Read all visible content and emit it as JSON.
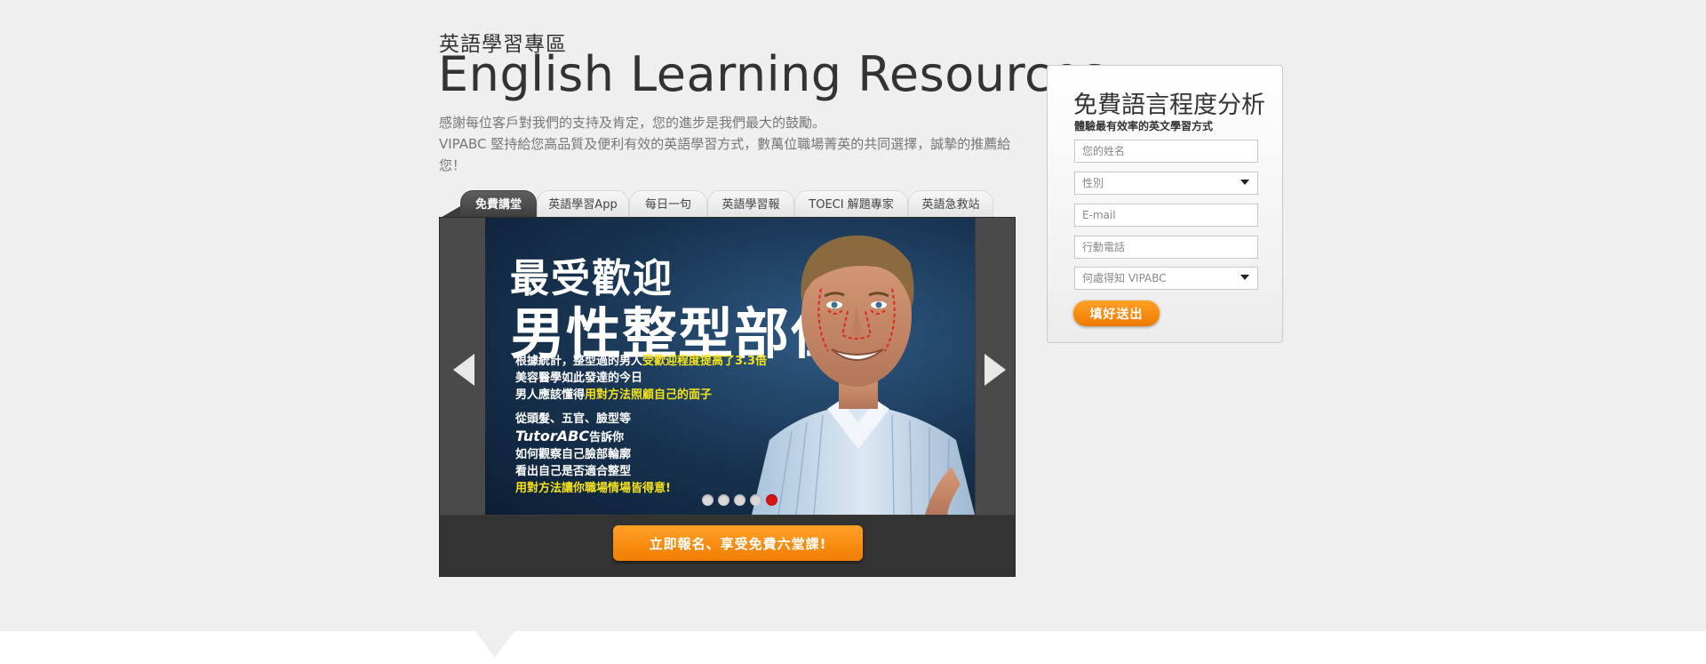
{
  "header": {
    "subtitle_zh": "英語學習專區",
    "title": "English Learning Resources",
    "intro_line1": "感謝每位客戶對我們的支持及肯定，您的進步是我們最大的鼓勵。",
    "intro_line2": "VIPABC 堅持給您高品質及便利有效的英語學習方式，數萬位職場菁英的共同選擇，誠摯的推薦給您！"
  },
  "tabs": [
    {
      "label": "免費講堂",
      "active": true
    },
    {
      "label": "英語學習App",
      "active": false
    },
    {
      "label": "每日一句",
      "active": false
    },
    {
      "label": "英語學習報",
      "active": false
    },
    {
      "label": "TOECI 解題專家",
      "active": false
    },
    {
      "label": "英語急救站",
      "active": false
    }
  ],
  "banner": {
    "headline1": "最受歡迎",
    "headline2": "男性整型部位",
    "line1_a": "根據統計，整型過的男人",
    "line1_b": "受歡迎程度提高了3.3倍",
    "line2": "美容醫學如此發達的今日",
    "line3_a": "男人應該懂得",
    "line3_b": "用對方法照顧自己的面子",
    "line4": "從頭髮、五官、臉型等",
    "line5_brand": "TutorABC",
    "line5_rest": "告訴你",
    "line6": "如何觀察自己臉部輪廓",
    "line7": "看出自己是否適合整型",
    "line8": "用對方法讓你職場情場皆得意!",
    "highlight_color": "#f5e21a",
    "slides_total": 5,
    "active_slide": 5
  },
  "cta": {
    "label": "立即報名、享受免費六堂課!"
  },
  "form": {
    "title": "免費語言程度分析",
    "subtitle": "體驗最有效率的英文學習方式",
    "name_placeholder": "您的姓名",
    "gender_value": "性別",
    "email_placeholder": "E-mail",
    "phone_placeholder": "行動電話",
    "source_value": "何處得知 VIPABC",
    "submit_label": "填好送出"
  },
  "icons": {
    "prev": "arrow-left-icon",
    "next": "arrow-right-icon",
    "dropdown": "caret-down-icon"
  },
  "colors": {
    "accent_orange": "#f58a07",
    "active_dot": "#d51414",
    "tab_active": "#444444"
  }
}
